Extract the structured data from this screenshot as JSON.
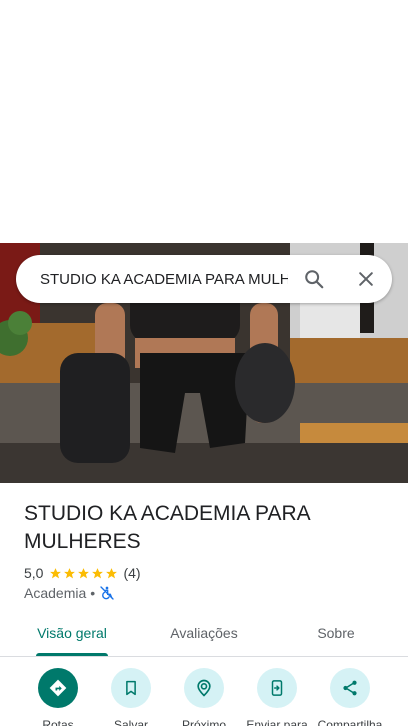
{
  "search": {
    "query": "STUDIO KA ACADEMIA PARA MULHERES"
  },
  "place": {
    "name": "STUDIO KA ACADEMIA PARA MULHERES",
    "rating": "5,0",
    "rating_value": 5,
    "review_count": "(4)",
    "category": "Academia",
    "separator": "•",
    "accessibility_icon": "no-wheelchair-icon"
  },
  "tabs": [
    {
      "label": "Visão geral",
      "active": true
    },
    {
      "label": "Avaliações",
      "active": false
    },
    {
      "label": "Sobre",
      "active": false
    }
  ],
  "actions": [
    {
      "label": "Rotas",
      "icon": "directions-icon"
    },
    {
      "label": "Salvar",
      "icon": "bookmark-icon"
    },
    {
      "label": "Próximo",
      "icon": "nearby-icon"
    },
    {
      "label": "Enviar para",
      "icon": "send-to-phone-icon"
    },
    {
      "label": "Compartilha",
      "icon": "share-icon"
    }
  ],
  "colors": {
    "accent": "#00796b",
    "action_bg": "#d5f2f5",
    "star": "#fbbc04",
    "accessibility_icon": "#1a73e8"
  }
}
